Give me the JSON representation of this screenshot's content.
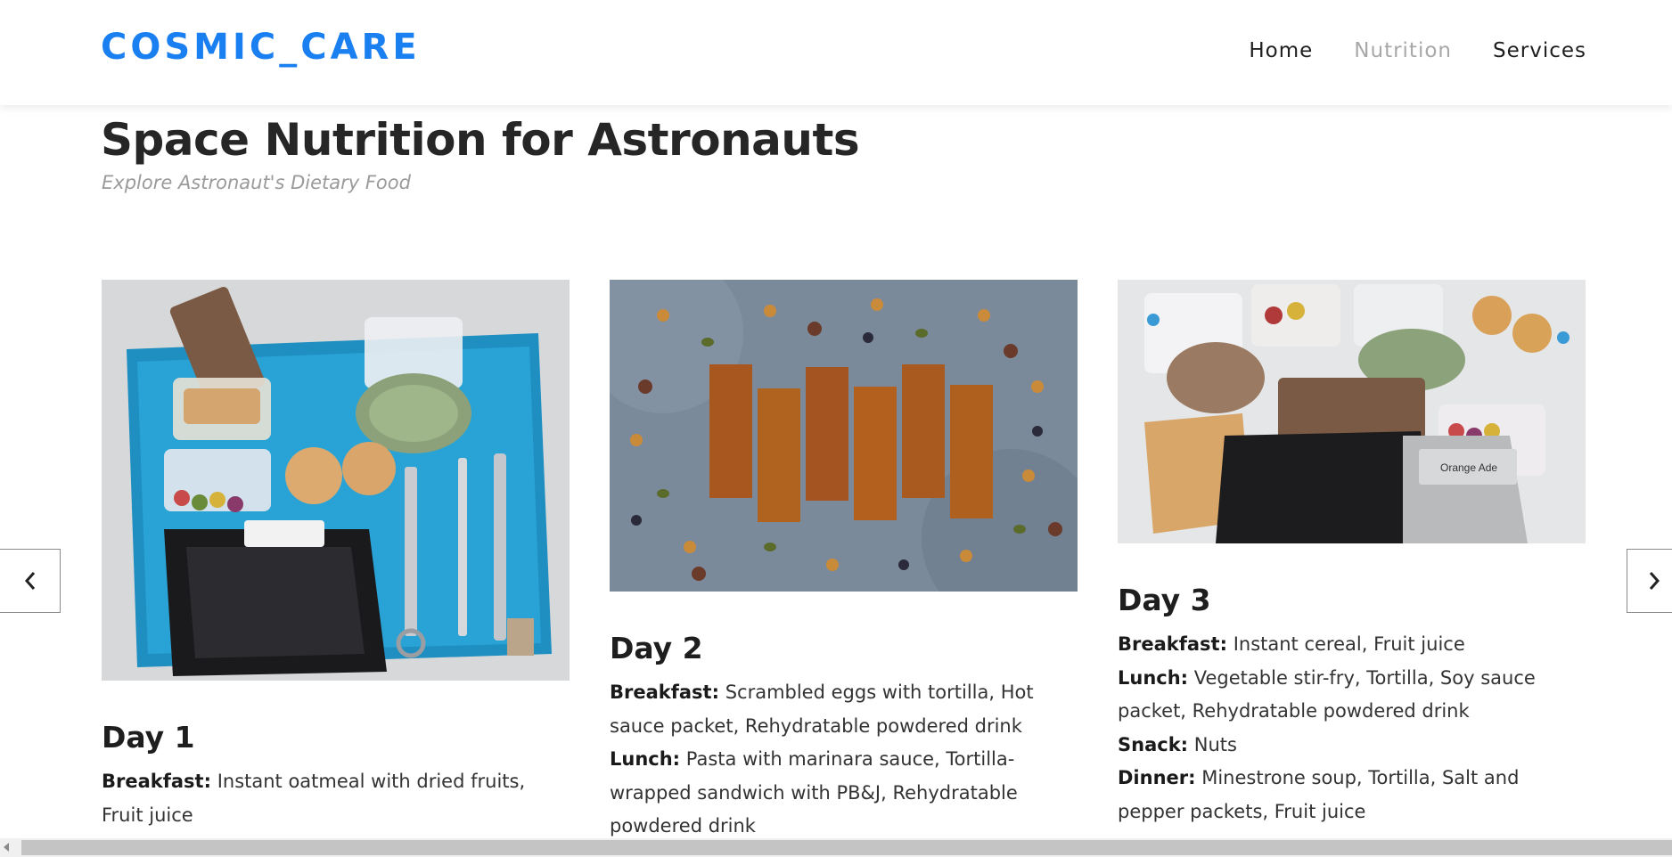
{
  "header": {
    "logo": "COSMIC_CARE",
    "nav": [
      {
        "label": "Home"
      },
      {
        "label": "Nutrition"
      },
      {
        "label": "Services"
      }
    ]
  },
  "page": {
    "title": "Space Nutrition for Astronauts",
    "subtitle": "Explore Astronaut's Dietary Food"
  },
  "cards": [
    {
      "day": "Day 1",
      "meals": [
        {
          "label": "Breakfast:",
          "text": "Instant oatmeal with dried fruits, Fruit juice"
        }
      ]
    },
    {
      "day": "Day 2",
      "meals": [
        {
          "label": "Breakfast:",
          "text": "Scrambled eggs with tortilla, Hot sauce packet, Rehydratable powdered drink"
        },
        {
          "label": "Lunch:",
          "text": "Pasta with marinara sauce, Tortilla-wrapped sandwich with PB&J, Rehydratable powdered drink"
        }
      ]
    },
    {
      "day": "Day 3",
      "meals": [
        {
          "label": "Breakfast:",
          "text": "Instant cereal, Fruit juice"
        },
        {
          "label": "Lunch:",
          "text": "Vegetable stir-fry, Tortilla, Soy sauce packet, Rehydratable powdered drink"
        },
        {
          "label": "Snack:",
          "text": "Nuts"
        },
        {
          "label": "Dinner:",
          "text": "Minestrone soup, Tortilla, Salt and pepper packets, Fruit juice"
        }
      ],
      "image_text": "Orange Ade"
    }
  ],
  "icons": {
    "prev": "chevron-left-icon",
    "next": "chevron-right-icon"
  },
  "colors": {
    "brand": "#1a7ff0",
    "nav_active": "#a8a8a8",
    "text": "#222222"
  }
}
